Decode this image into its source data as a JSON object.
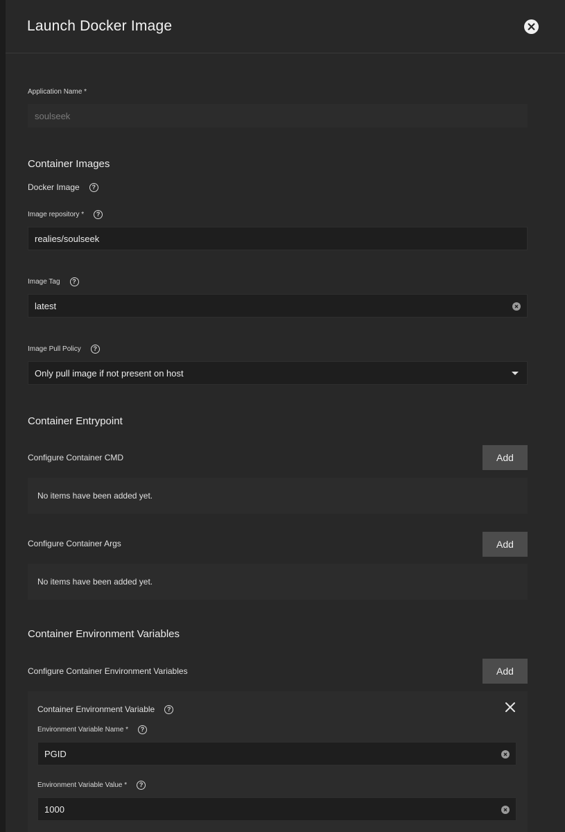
{
  "dialog": {
    "title": "Launch Docker Image"
  },
  "app_name": {
    "label": "Application Name *",
    "value": "soulseek"
  },
  "container_images": {
    "section_title": "Container Images",
    "docker_image_label": "Docker Image",
    "repository": {
      "label": "Image repository *",
      "value": "realies/soulseek"
    },
    "tag": {
      "label": "Image Tag",
      "value": "latest"
    },
    "pull_policy": {
      "label": "Image Pull Policy",
      "value": "Only pull image if not present on host"
    }
  },
  "entrypoint": {
    "section_title": "Container Entrypoint",
    "cmd": {
      "label": "Configure Container CMD",
      "add_label": "Add",
      "empty_text": "No items have been added yet."
    },
    "args": {
      "label": "Configure Container Args",
      "add_label": "Add",
      "empty_text": "No items have been added yet."
    }
  },
  "env_vars": {
    "section_title": "Container Environment Variables",
    "configure_label": "Configure Container Environment Variables",
    "add_label": "Add",
    "item": {
      "title": "Container Environment Variable",
      "name_label": "Environment Variable Name *",
      "name_value": "PGID",
      "value_label": "Environment Variable Value *",
      "value_value": "1000"
    }
  },
  "icons": {
    "help": "?",
    "help_icon": "question-circle-icon",
    "close_icon": "close-circle-icon",
    "clear_icon": "clear-circle-icon",
    "dropdown_icon": "caret-down-icon"
  }
}
